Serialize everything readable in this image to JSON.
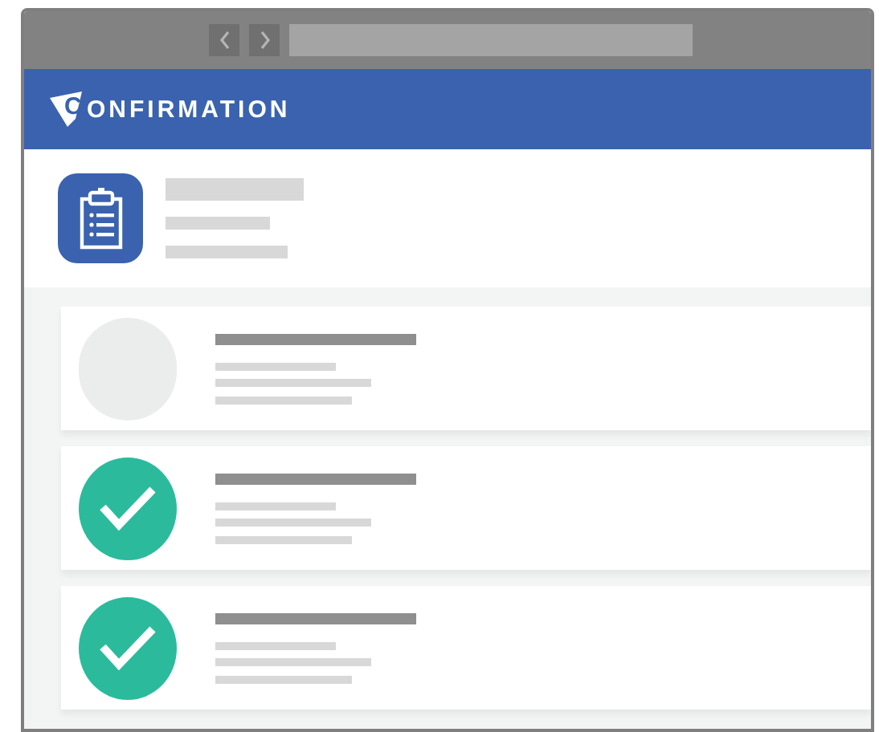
{
  "header": {
    "logo_letter": "C",
    "brand": "ONFIRMATION"
  },
  "items": [
    {
      "checked": false
    },
    {
      "checked": true
    },
    {
      "checked": true
    }
  ]
}
